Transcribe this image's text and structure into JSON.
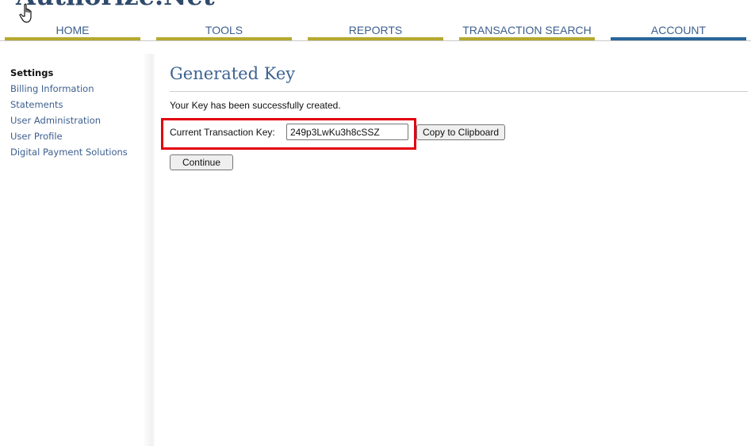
{
  "header": {
    "logo_text": "Authorize.Net"
  },
  "nav": {
    "tabs": [
      {
        "label": "HOME",
        "active": false
      },
      {
        "label": "TOOLS",
        "active": false
      },
      {
        "label": "REPORTS",
        "active": false
      },
      {
        "label": "TRANSACTION SEARCH",
        "active": false
      },
      {
        "label": "ACCOUNT",
        "active": true
      }
    ],
    "colors": {
      "inactive_bar": "#b5a92f",
      "active_bar": "#2a6699",
      "label": "#3d5f8e"
    }
  },
  "sidebar": {
    "items": [
      {
        "label": "Settings",
        "current": true
      },
      {
        "label": "Billing Information",
        "current": false
      },
      {
        "label": "Statements",
        "current": false
      },
      {
        "label": "User Administration",
        "current": false
      },
      {
        "label": "User Profile",
        "current": false
      },
      {
        "label": "Digital Payment Solutions",
        "current": false
      }
    ]
  },
  "main": {
    "title": "Generated Key",
    "message": "Your Key has been successfully created.",
    "key_label": "Current Transaction Key:",
    "key_value": "249p3LwKu3h8cSSZ",
    "copy_button": "Copy to Clipboard",
    "continue_button": "Continue",
    "highlight_color": "#e3000f"
  }
}
